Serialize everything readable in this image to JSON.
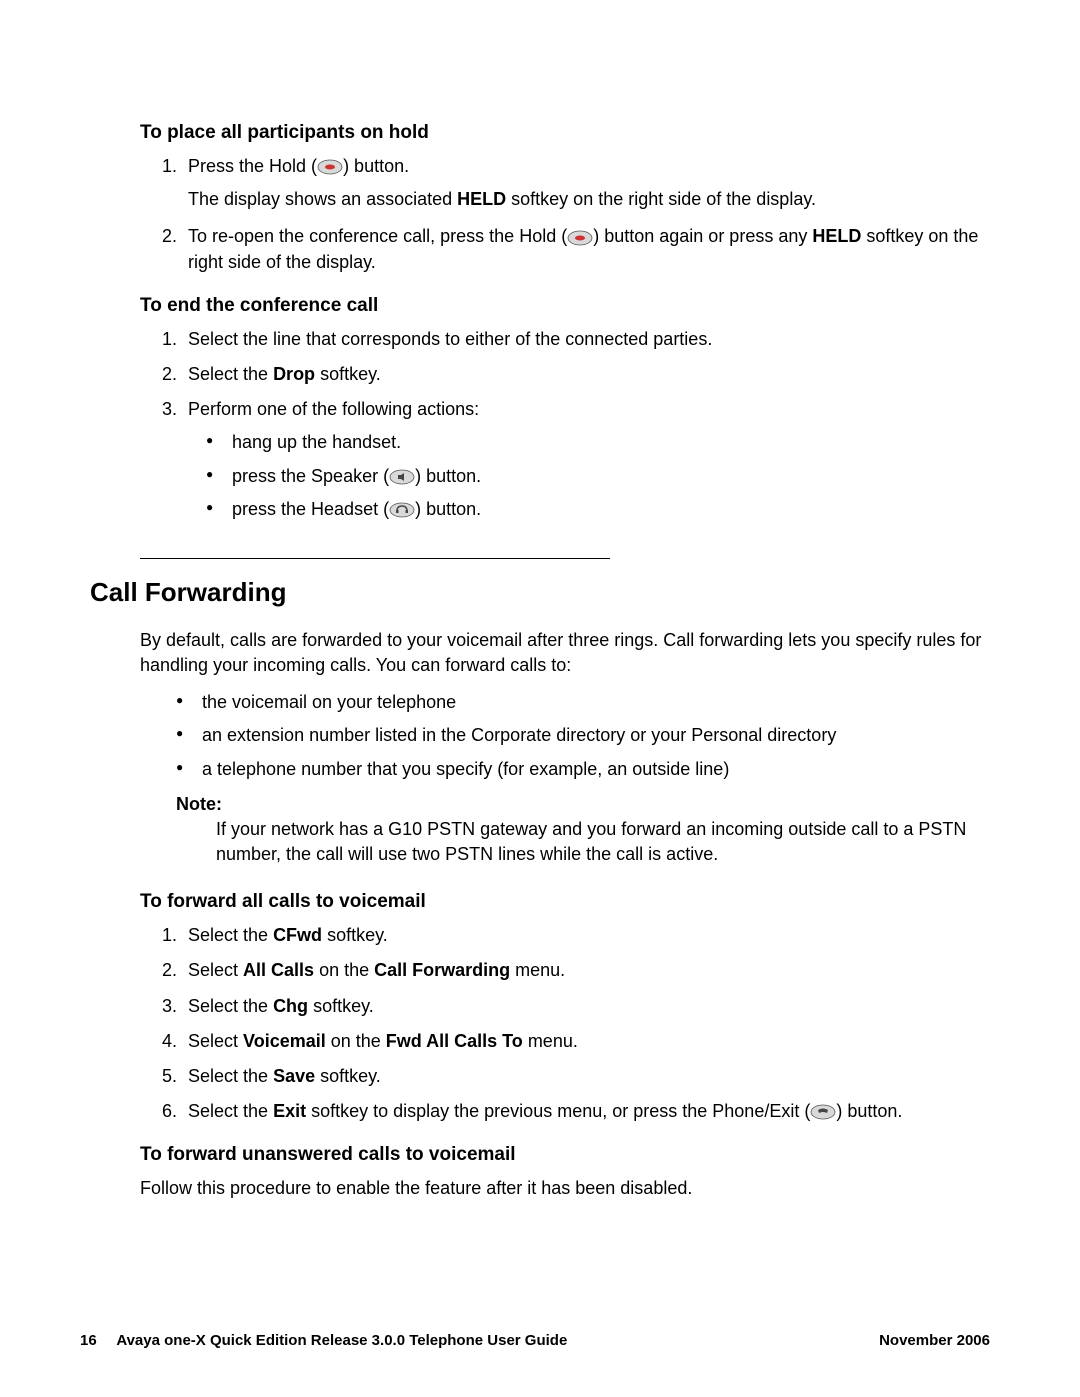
{
  "sections": {
    "hold": {
      "heading": "To place all participants on hold",
      "step1_a": "Press the Hold (",
      "step1_b": ") button.",
      "step1_follow_a": "The display shows an associated ",
      "step1_follow_b": "HELD",
      "step1_follow_c": " softkey on the right side of the display.",
      "step2_a": "To re-open the conference call, press the Hold (",
      "step2_b": ") button again or press any ",
      "step2_c": "HELD",
      "step2_d": " softkey on the right side of the display."
    },
    "end": {
      "heading": "To end the conference call",
      "step1": "Select the line that corresponds to either of the connected parties.",
      "step2_a": "Select the ",
      "step2_b": "Drop",
      "step2_c": " softkey.",
      "step3": "Perform one of the following actions:",
      "b1": "hang up the handset.",
      "b2_a": "press the Speaker (",
      "b2_b": ") button.",
      "b3_a": "press the Headset (",
      "b3_b": ") button."
    },
    "cf": {
      "title": "Call Forwarding",
      "intro": "By default, calls are forwarded to your voicemail after three rings. Call forwarding lets you specify rules for handling your incoming calls. You can forward calls to:",
      "b1": "the voicemail on your telephone",
      "b2": "an extension number listed in the Corporate directory or your Personal directory",
      "b3": "a telephone number that you specify (for example, an outside line)",
      "note_label": "Note:",
      "note_text": "If your network has a G10 PSTN gateway and you forward an incoming outside call to a PSTN number, the call will use two PSTN lines while the call is active."
    },
    "fwd_all": {
      "heading": "To forward all calls to voicemail",
      "s1_a": "Select the ",
      "s1_b": "CFwd",
      "s1_c": " softkey.",
      "s2_a": "Select ",
      "s2_b": "All Calls",
      "s2_c": " on the ",
      "s2_d": "Call Forwarding",
      "s2_e": " menu.",
      "s3_a": "Select the ",
      "s3_b": "Chg",
      "s3_c": " softkey.",
      "s4_a": "Select ",
      "s4_b": "Voicemail",
      "s4_c": " on the ",
      "s4_d": "Fwd All Calls To",
      "s4_e": " menu.",
      "s5_a": "Select the ",
      "s5_b": "Save",
      "s5_c": " softkey.",
      "s6_a": "Select the ",
      "s6_b": "Exit",
      "s6_c": " softkey to display the previous menu, or press the Phone/Exit (",
      "s6_d": ") button."
    },
    "fwd_un": {
      "heading": "To forward unanswered calls to voicemail",
      "text": "Follow this procedure to enable the feature after it has been disabled."
    }
  },
  "footer": {
    "page": "16",
    "left": "Avaya one-X Quick Edition Release 3.0.0 Telephone User Guide",
    "right": "November 2006"
  }
}
